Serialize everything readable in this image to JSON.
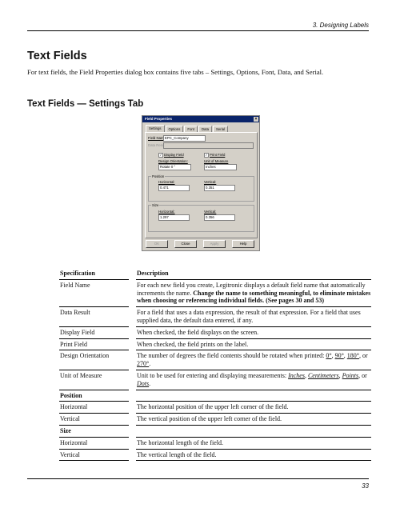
{
  "header": {
    "chapter": "3. Designing Labels"
  },
  "title": "Text Fields",
  "intro": "For text fields, the Field Properties dialog box contains five tabs – Settings, Options, Font, Data, and Serial.",
  "subtitle": "Text Fields — Settings Tab",
  "dialog": {
    "title": "Field Properties",
    "close_glyph": "×",
    "tabs": [
      "Settings",
      "Options",
      "Font",
      "Data",
      "Serial"
    ],
    "field_name_label": "Field Name:",
    "field_name_value": "EPC_Company",
    "data_result_label": "Data Result:",
    "display_field_label": "Display Field",
    "print_field_label": "Print Field",
    "check_glyph": "✓",
    "design_orientation_label": "Design Orientation:",
    "design_orientation_value": "Rotate 0 °",
    "unit_label": "Unit of Measure",
    "unit_value": "Inches",
    "position_label": "Position",
    "size_label": "Size",
    "horizontal_label": "Horizontal:",
    "vertical_label": "Vertical:",
    "pos_h": "0.471",
    "pos_v": "0.351",
    "size_h": "1.297",
    "size_v": "0.356",
    "buttons": [
      "OK",
      "Close",
      "Apply",
      "Help"
    ]
  },
  "table": {
    "headers": [
      "Specification",
      "Description"
    ],
    "rows": [
      {
        "spec": "Field Name",
        "desc_a": "For each new field you create, Legitronic displays a default field name that automatically increments the name. ",
        "desc_b": "Change the name to something meaningful, to eliminate mistakes when choosing or referencing individual fields. (See pages 30 and 53)"
      },
      {
        "spec": "Data Result",
        "desc": "For a field that uses a data expression, the result of that expression. For a field that uses supplied data, the default data entered, if any."
      },
      {
        "spec": "Display Field",
        "desc": "When checked, the field displays on the screen."
      },
      {
        "spec": "Print Field",
        "desc": "When checked, the field prints on the label."
      },
      {
        "spec": "Design Orientation",
        "desc_a": "The number of degrees the field contents should be rotated when printed: ",
        "o1": "0°",
        "o2": "90°",
        "o3": "180°",
        "o4": "270°",
        "sep1": ", ",
        "sep2": ", ",
        "sep3": ", or ",
        "end": "."
      },
      {
        "spec": "Unit of Measure",
        "desc_a": "Unit to be used for entering and displaying measurements: ",
        "u1": "Inches",
        "u2": "Centimeters",
        "u3": "Points",
        "u4": "Dots",
        "sep1": ", ",
        "sep2": ", ",
        "sep3": ", or ",
        "end": "."
      },
      {
        "section": "Position"
      },
      {
        "spec": "Horizontal",
        "desc": "The horizontal position of the upper left corner of the field."
      },
      {
        "spec": "Vertical",
        "desc": "The vertical position of the upper left corner of the field."
      },
      {
        "section": "Size"
      },
      {
        "spec": "Horizontal",
        "desc": "The horizontal length of the field."
      },
      {
        "spec": "Vertical",
        "desc": "The vertical length of the field."
      }
    ]
  },
  "footer": {
    "page_number": "33"
  }
}
